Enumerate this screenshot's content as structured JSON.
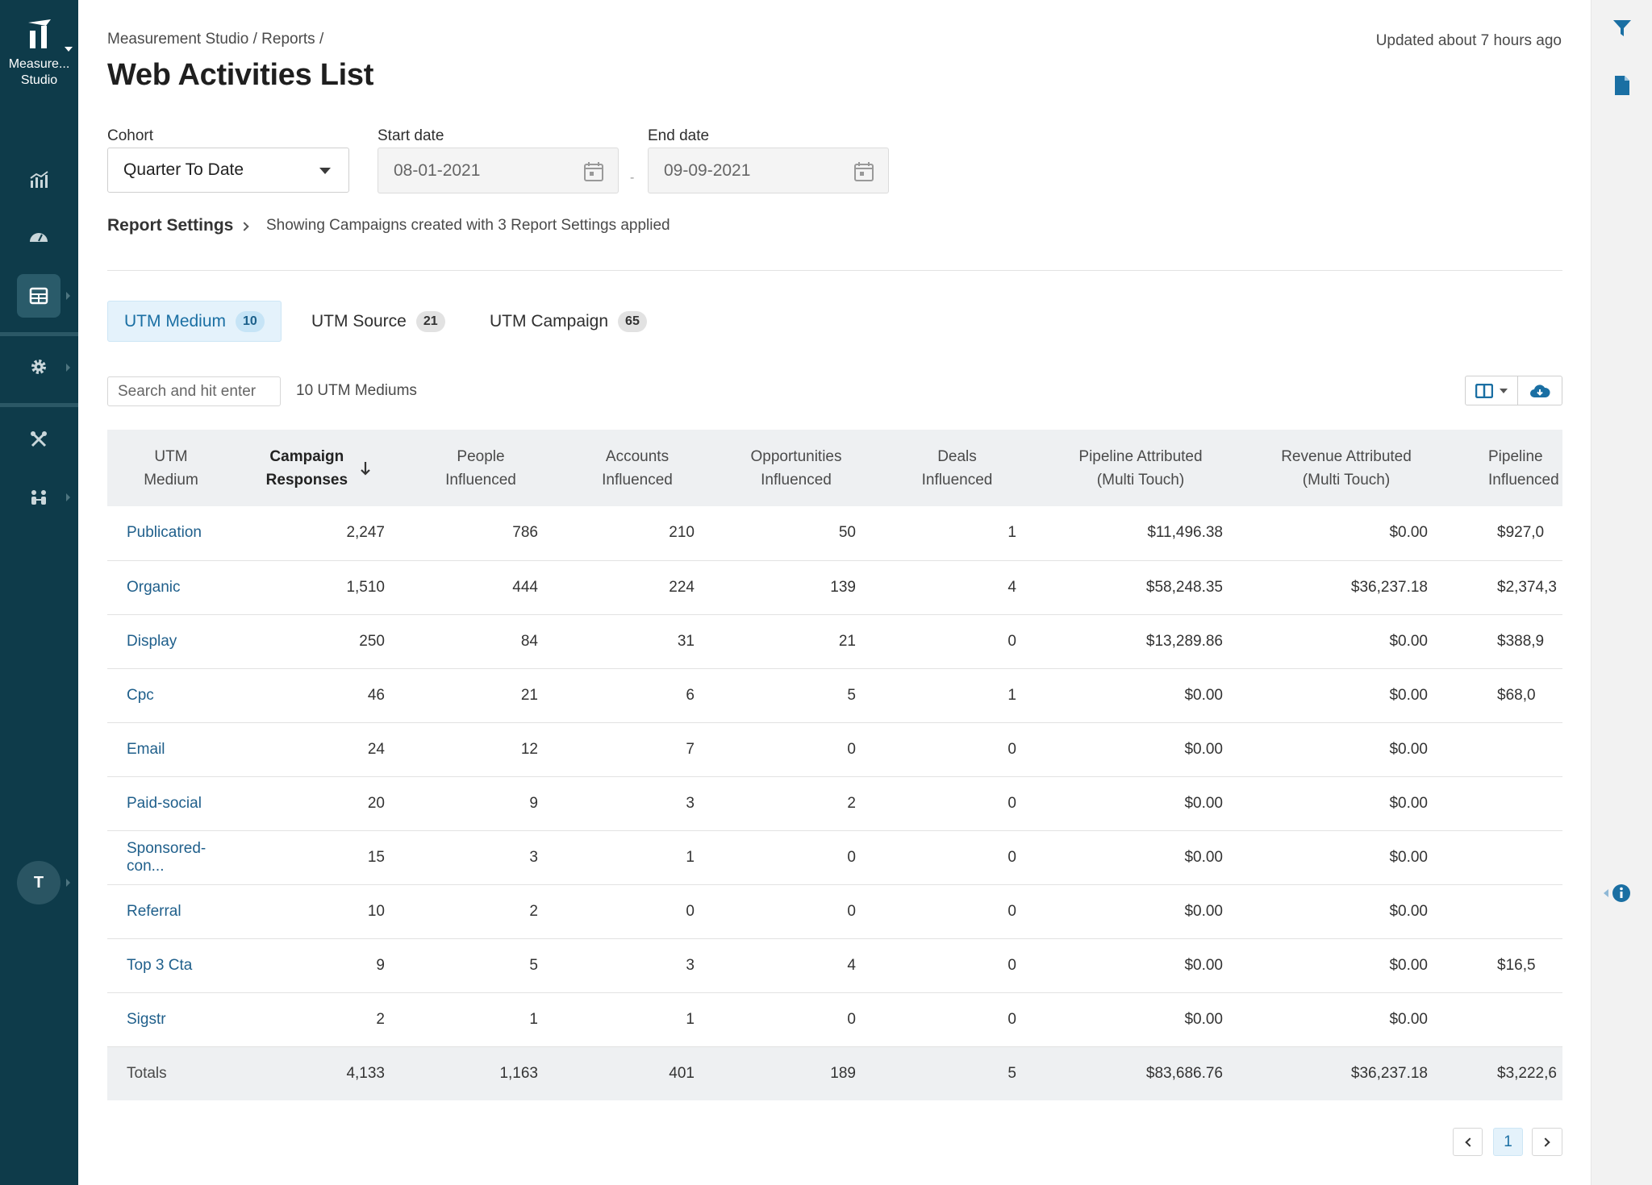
{
  "brand": {
    "name": "Measure... Studio"
  },
  "breadcrumb": "Measurement Studio / Reports /",
  "title": "Web Activities List",
  "updated": "Updated about 7 hours ago",
  "filters": {
    "cohort_label": "Cohort",
    "cohort_value": "Quarter To Date",
    "start_label": "Start date",
    "start_value": "08-01-2021",
    "end_label": "End date",
    "end_value": "09-09-2021",
    "date_separator": "-"
  },
  "report_settings": {
    "label": "Report Settings",
    "summary": "Showing Campaigns created with 3 Report Settings applied"
  },
  "tabs": [
    {
      "label": "UTM Medium",
      "count": "10",
      "active": true
    },
    {
      "label": "UTM Source",
      "count": "21",
      "active": false
    },
    {
      "label": "UTM Campaign",
      "count": "65",
      "active": false
    }
  ],
  "search": {
    "placeholder": "Search and hit enter"
  },
  "result_count": "10 UTM Mediums",
  "avatar_initial": "T",
  "table": {
    "columns": [
      [
        "UTM",
        "Medium"
      ],
      [
        "Campaign",
        "Responses"
      ],
      [
        "People",
        "Influenced"
      ],
      [
        "Accounts",
        "Influenced"
      ],
      [
        "Opportunities",
        "Influenced"
      ],
      [
        "Deals",
        "Influenced"
      ],
      [
        "Pipeline Attributed",
        "(Multi Touch)"
      ],
      [
        "Revenue Attributed",
        "(Multi Touch)"
      ],
      [
        "Pipeline",
        "Influenced"
      ]
    ],
    "rows": [
      [
        "Publication",
        "2,247",
        "786",
        "210",
        "50",
        "1",
        "$11,496.38",
        "$0.00",
        "$927,0"
      ],
      [
        "Organic",
        "1,510",
        "444",
        "224",
        "139",
        "4",
        "$58,248.35",
        "$36,237.18",
        "$2,374,3"
      ],
      [
        "Display",
        "250",
        "84",
        "31",
        "21",
        "0",
        "$13,289.86",
        "$0.00",
        "$388,9"
      ],
      [
        "Cpc",
        "46",
        "21",
        "6",
        "5",
        "1",
        "$0.00",
        "$0.00",
        "$68,0"
      ],
      [
        "Email",
        "24",
        "12",
        "7",
        "0",
        "0",
        "$0.00",
        "$0.00",
        ""
      ],
      [
        "Paid-social",
        "20",
        "9",
        "3",
        "2",
        "0",
        "$0.00",
        "$0.00",
        ""
      ],
      [
        "Sponsored-con...",
        "15",
        "3",
        "1",
        "0",
        "0",
        "$0.00",
        "$0.00",
        ""
      ],
      [
        "Referral",
        "10",
        "2",
        "0",
        "0",
        "0",
        "$0.00",
        "$0.00",
        ""
      ],
      [
        "Top 3 Cta",
        "9",
        "5",
        "3",
        "4",
        "0",
        "$0.00",
        "$0.00",
        "$16,5"
      ],
      [
        "Sigstr",
        "2",
        "1",
        "1",
        "0",
        "0",
        "$0.00",
        "$0.00",
        ""
      ]
    ],
    "totals": [
      "Totals",
      "4,133",
      "1,163",
      "401",
      "189",
      "5",
      "$83,686.76",
      "$36,237.18",
      "$3,222,6"
    ]
  },
  "pagination": {
    "current": "1"
  },
  "colors": {
    "nav_bg": "#0e3b4a",
    "accent": "#1a6fa3",
    "link": "#1f5f8b"
  }
}
